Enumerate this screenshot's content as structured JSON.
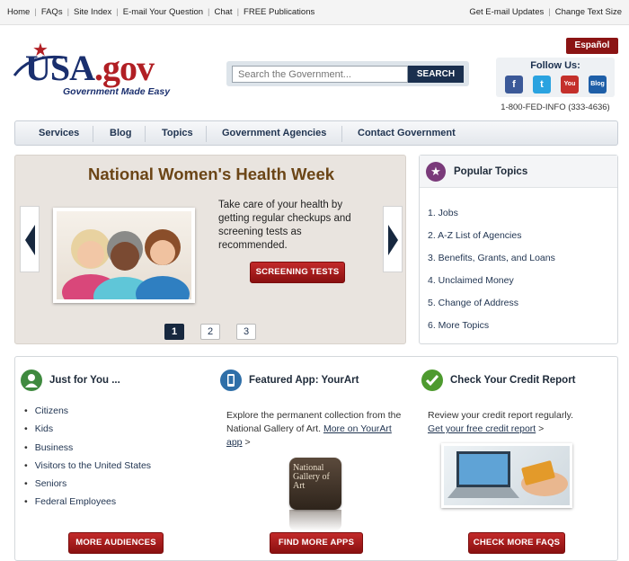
{
  "topbar": {
    "left_links": [
      "Home",
      "FAQs",
      "Site Index",
      "E-mail Your Question",
      "Chat",
      "FREE Publications"
    ],
    "right_links": [
      "Get E-mail Updates",
      "Change Text Size"
    ]
  },
  "header": {
    "logo_usa": "USA",
    "logo_gov": ".gov",
    "tagline": "Government Made Easy",
    "search_placeholder": "Search the Government...",
    "search_button": "SEARCH",
    "espanol": "Español",
    "follow_label": "Follow Us:",
    "social": [
      {
        "name": "facebook",
        "glyph": "f",
        "color": "#3b5998"
      },
      {
        "name": "twitter",
        "glyph": "t",
        "color": "#2aa3e0"
      },
      {
        "name": "youtube",
        "glyph": "You",
        "color": "#c4302b"
      },
      {
        "name": "blog",
        "glyph": "Blog",
        "color": "#1e5fa8"
      }
    ],
    "phone": "1-800-FED-INFO (333-4636)"
  },
  "nav": {
    "items": [
      "Services",
      "Blog",
      "Topics",
      "Government Agencies",
      "Contact Government"
    ]
  },
  "feature": {
    "title": "National Women's Health Week",
    "description": "Take care of your health by getting regular checkups and screening tests as recommended.",
    "button": "SCREENING TESTS",
    "pages": [
      "1",
      "2",
      "3"
    ],
    "active_page": "1"
  },
  "popular": {
    "title": "Popular Topics",
    "items": [
      "1. Jobs",
      "2. A-Z List of Agencies",
      "3. Benefits, Grants, and Loans",
      "4. Unclaimed Money",
      "5. Change of Address",
      "6. More Topics"
    ]
  },
  "just_for_you": {
    "title": "Just for You ...",
    "items": [
      "Citizens",
      "Kids",
      "Business",
      "Visitors to the United States",
      "Seniors",
      "Federal Employees"
    ],
    "button": "MORE AUDIENCES",
    "icon_color": "#3f8a3f"
  },
  "featured_app": {
    "title": "Featured App: YourArt",
    "text": "Explore the permanent collection from the National Gallery of Art.",
    "link": "More on YourArt app",
    "arrow": ">",
    "app_icon_text": "National Gallery of Art",
    "button": "FIND MORE APPS",
    "icon_color": "#2f6fa8"
  },
  "credit": {
    "title": "Check Your Credit Report",
    "text": "Review your credit report regularly.",
    "link": "Get your free credit report",
    "arrow": ">",
    "button": "CHECK MORE FAQS",
    "icon_color": "#4d9a2e"
  }
}
